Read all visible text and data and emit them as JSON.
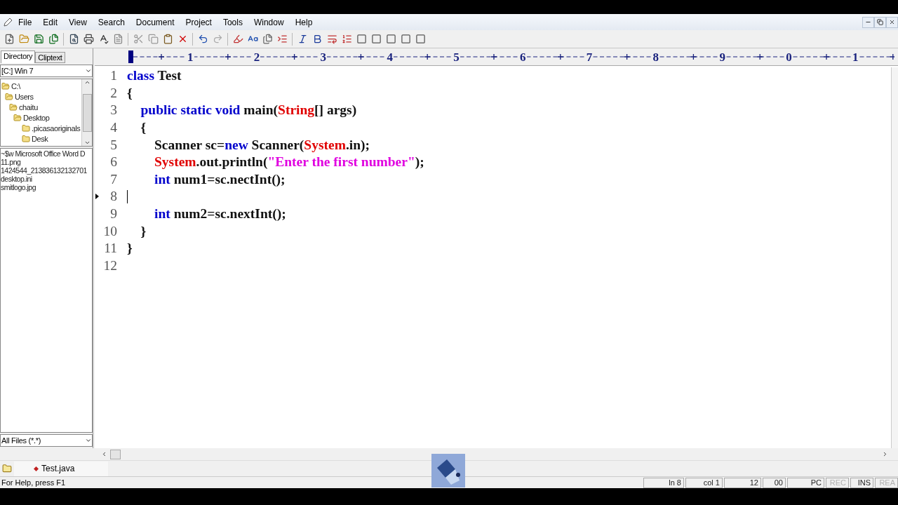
{
  "menu": [
    "File",
    "Edit",
    "View",
    "Search",
    "Document",
    "Project",
    "Tools",
    "Window",
    "Help"
  ],
  "side_tabs": [
    {
      "label": "Directory",
      "selected": true
    },
    {
      "label": "Cliptext",
      "selected": false
    }
  ],
  "drive": {
    "value": "[C:] Win 7"
  },
  "folders": [
    {
      "name": "C:\\",
      "expanded": true,
      "children": [
        {
          "name": "Users",
          "expanded": true,
          "children": [
            {
              "name": "chaitu",
              "expanded": true,
              "children": [
                {
                  "name": "Desktop",
                  "expanded": true,
                  "children": [
                    {
                      "name": ".picasaoriginals",
                      "expanded": false
                    },
                    {
                      "name": "Desk",
                      "expanded": false
                    }
                  ]
                }
              ]
            }
          ]
        }
      ]
    }
  ],
  "files": [
    "~$w Microsoft Office Word D",
    "11.png",
    "1424544_213836132132701",
    "desktop.ini",
    "smitlogo.jpg"
  ],
  "filter": {
    "value": "All Files (*.*)"
  },
  "ruler": [
    "1",
    "2",
    "3",
    "4",
    "5",
    "6",
    "7",
    "8",
    "9",
    "0",
    "1"
  ],
  "code": [
    {
      "number": "1",
      "current": false,
      "tokens": [
        {
          "kind": "keyword",
          "text": "class"
        },
        {
          "kind": "plain",
          "text": " Test"
        }
      ]
    },
    {
      "number": "2",
      "current": false,
      "tokens": [
        {
          "kind": "plain",
          "text": "{"
        }
      ]
    },
    {
      "number": "3",
      "current": false,
      "tokens": [
        {
          "kind": "keyword",
          "text": "    public static void"
        },
        {
          "kind": "plain",
          "text": " main("
        },
        {
          "kind": "class",
          "text": "String"
        },
        {
          "kind": "plain",
          "text": "[] args)"
        }
      ]
    },
    {
      "number": "4",
      "current": false,
      "tokens": [
        {
          "kind": "plain",
          "text": "    {"
        }
      ]
    },
    {
      "number": "5",
      "current": false,
      "tokens": [
        {
          "kind": "plain",
          "text": "        Scanner sc="
        },
        {
          "kind": "keyword",
          "text": "new"
        },
        {
          "kind": "plain",
          "text": " Scanner("
        },
        {
          "kind": "class",
          "text": "System"
        },
        {
          "kind": "plain",
          "text": ".in);"
        }
      ]
    },
    {
      "number": "6",
      "current": false,
      "tokens": [
        {
          "kind": "class",
          "text": "        System"
        },
        {
          "kind": "plain",
          "text": ".out.println("
        },
        {
          "kind": "string",
          "text": "\"Enter the first number\""
        },
        {
          "kind": "plain",
          "text": ");"
        }
      ]
    },
    {
      "number": "7",
      "current": false,
      "tokens": [
        {
          "kind": "keyword",
          "text": "        int"
        },
        {
          "kind": "plain",
          "text": " num1=sc.nectInt();"
        }
      ]
    },
    {
      "number": "8",
      "current": true
    },
    {
      "number": "9",
      "current": false,
      "tokens": [
        {
          "kind": "keyword",
          "text": "        int"
        },
        {
          "kind": "plain",
          "text": " num2=sc.nextInt();"
        }
      ]
    },
    {
      "number": "10",
      "current": false,
      "tokens": [
        {
          "kind": "plain",
          "text": "    }"
        }
      ]
    },
    {
      "number": "11",
      "current": false,
      "tokens": [
        {
          "kind": "plain",
          "text": "}"
        }
      ]
    },
    {
      "number": "12",
      "current": false
    }
  ],
  "doc_tabs": [
    {
      "label": "Test.java",
      "selected": true
    }
  ],
  "status_bar": {
    "help": "For Help, press F1",
    "panels": [
      {
        "text": "ln 8",
        "disabled": false
      },
      {
        "text": "col 1",
        "disabled": false
      },
      {
        "text": "12",
        "disabled": false
      },
      {
        "text": "00",
        "disabled": false
      },
      {
        "text": "PC",
        "disabled": false
      },
      {
        "text": "REC",
        "disabled": true
      },
      {
        "text": "INS",
        "disabled": false
      },
      {
        "text": "REA",
        "disabled": true
      }
    ]
  }
}
